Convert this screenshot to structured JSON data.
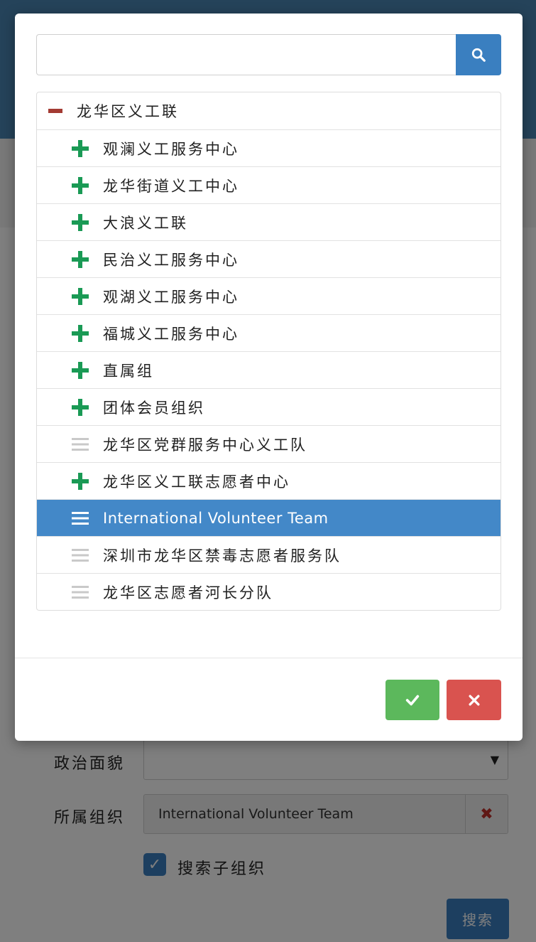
{
  "background_form": {
    "political_status_label": "政治面貌",
    "political_status_value": "",
    "org_label": "所属组织",
    "org_value": "International Volunteer Team",
    "include_children_label": "搜索子组织",
    "search_button_label": "搜索"
  },
  "dialog": {
    "search": {
      "value": "",
      "placeholder": ""
    },
    "tree": {
      "root": {
        "label": "龙华区义工联",
        "icon": "minus-icon"
      },
      "children": [
        {
          "label": "观澜义工服务中心",
          "icon": "plus-icon"
        },
        {
          "label": "龙华街道义工中心",
          "icon": "plus-icon"
        },
        {
          "label": "大浪义工联",
          "icon": "plus-icon"
        },
        {
          "label": "民治义工服务中心",
          "icon": "plus-icon"
        },
        {
          "label": "观湖义工服务中心",
          "icon": "plus-icon"
        },
        {
          "label": "福城义工服务中心",
          "icon": "plus-icon"
        },
        {
          "label": "直属组",
          "icon": "plus-icon"
        },
        {
          "label": "团体会员组织",
          "icon": "plus-icon"
        },
        {
          "label": "龙华区党群服务中心义工队",
          "icon": "list-icon"
        },
        {
          "label": "龙华区义工联志愿者中心",
          "icon": "plus-icon"
        },
        {
          "label": "International Volunteer Team",
          "icon": "list-icon",
          "selected": true
        },
        {
          "label": "深圳市龙华区禁毒志愿者服务队",
          "icon": "list-icon"
        },
        {
          "label": "龙华区志愿者河长分队",
          "icon": "list-icon"
        }
      ]
    }
  },
  "colors": {
    "primary": "#3a7fc0",
    "selected_row": "#4388c8",
    "plus_icon": "#1a9a55",
    "minus_icon": "#a33b33",
    "list_icon": "#c9c9c9",
    "confirm": "#5cb85c",
    "cancel": "#d9534f"
  }
}
